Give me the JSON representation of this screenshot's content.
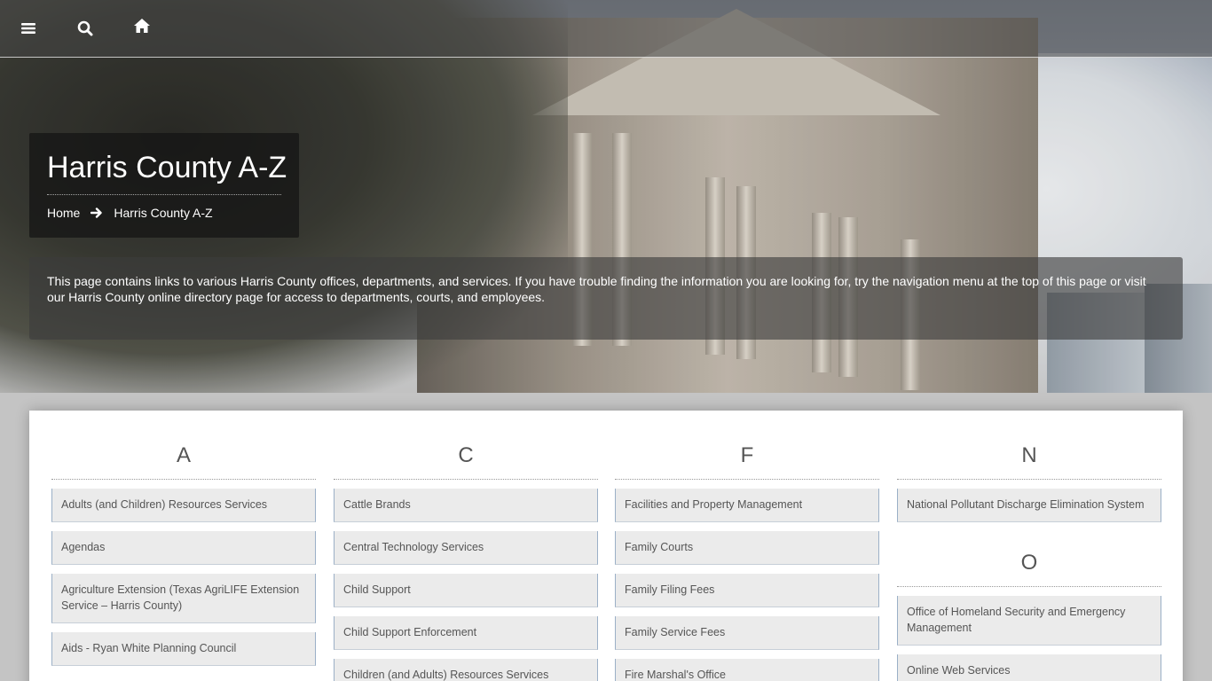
{
  "nav": {
    "menu_icon": "menu-icon",
    "search_icon": "search-icon",
    "home_icon": "home-icon"
  },
  "page": {
    "title": "Harris County A-Z",
    "breadcrumb": {
      "home": "Home",
      "current": "Harris County A-Z"
    },
    "intro": "This page contains links to various Harris County offices, departments, and services. If you have trouble finding the information you are looking for, try the navigation menu at the top of this page or visit our Harris County online directory page for access to departments, courts, and employees."
  },
  "columns": [
    {
      "letter": "A",
      "items": [
        "Adults (and Children) Resources Services",
        "Agendas",
        "Agriculture Extension (Texas AgriLIFE Extension Service – Harris County)",
        "Aids - Ryan White Planning Council"
      ]
    },
    {
      "letter": "C",
      "items": [
        "Cattle Brands",
        "Central Technology Services",
        "Child Support",
        "Child Support Enforcement",
        "Children (and Adults) Resources Services"
      ]
    },
    {
      "letter": "F",
      "items": [
        "Facilities and Property Management",
        "Family Courts",
        "Family Filing Fees",
        "Family Service Fees",
        "Fire Marshal's Office"
      ]
    },
    {
      "letter": "N",
      "items": [
        "National Pollutant Discharge Elimination System"
      ],
      "second_letter": "O",
      "second_items": [
        "Office of Homeland Security and Emergency Management",
        "Online Web Services"
      ]
    }
  ]
}
